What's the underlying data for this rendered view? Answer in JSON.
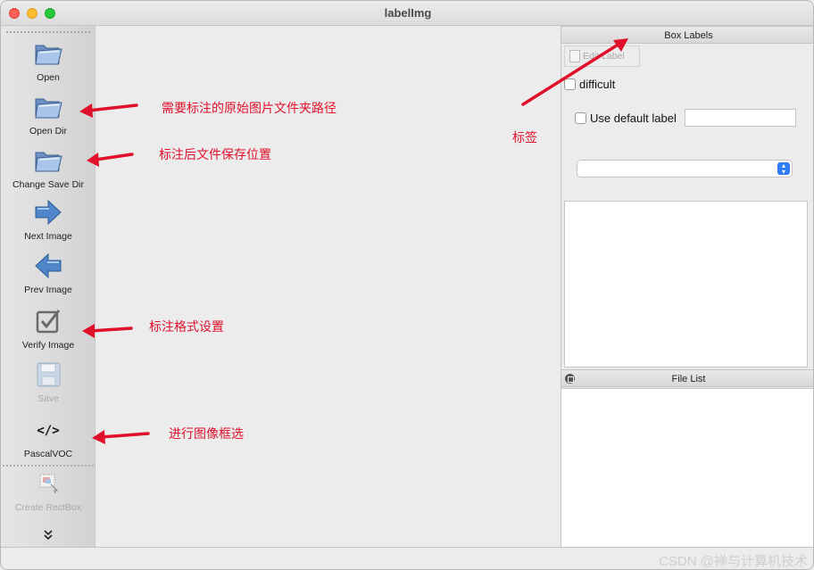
{
  "window": {
    "title": "labelImg"
  },
  "toolbar": {
    "items": [
      {
        "label": "Open",
        "icon": "folder-icon",
        "enabled": true
      },
      {
        "label": "Open Dir",
        "icon": "folder-icon",
        "enabled": true
      },
      {
        "label": "Change Save Dir",
        "icon": "folder-icon",
        "enabled": true
      },
      {
        "label": "Next Image",
        "icon": "arrow-right-icon",
        "enabled": true
      },
      {
        "label": "Prev Image",
        "icon": "arrow-left-icon",
        "enabled": true
      },
      {
        "label": "Verify Image",
        "icon": "checkbox-icon",
        "enabled": true
      },
      {
        "label": "Save",
        "icon": "floppy-disk-icon",
        "enabled": false
      },
      {
        "label": "PascalVOC",
        "icon": "code-icon",
        "enabled": true
      },
      {
        "label": "Create RectBox",
        "icon": "rect-box-icon",
        "enabled": false
      }
    ],
    "more_icon": "chevron-double-down-icon"
  },
  "box_labels": {
    "title": "Box Labels",
    "edit_label": "Edit Label",
    "difficult_label": "difficult",
    "use_default_label": "Use default label",
    "default_label_value": "",
    "combo_value": ""
  },
  "file_list": {
    "title": "File List"
  },
  "annotations": {
    "open_dir_note": "需要标注的原始图片文件夹路径",
    "save_dir_note": "标注后文件保存位置",
    "verify_note": "标注格式设置",
    "pascal_note": "进行图像框选",
    "labels_note": "标签"
  },
  "status": {
    "watermark": "CSDN @禅与计算机技术"
  },
  "colors": {
    "annotation": "#e0102a",
    "accent": "#2f7cf6"
  }
}
